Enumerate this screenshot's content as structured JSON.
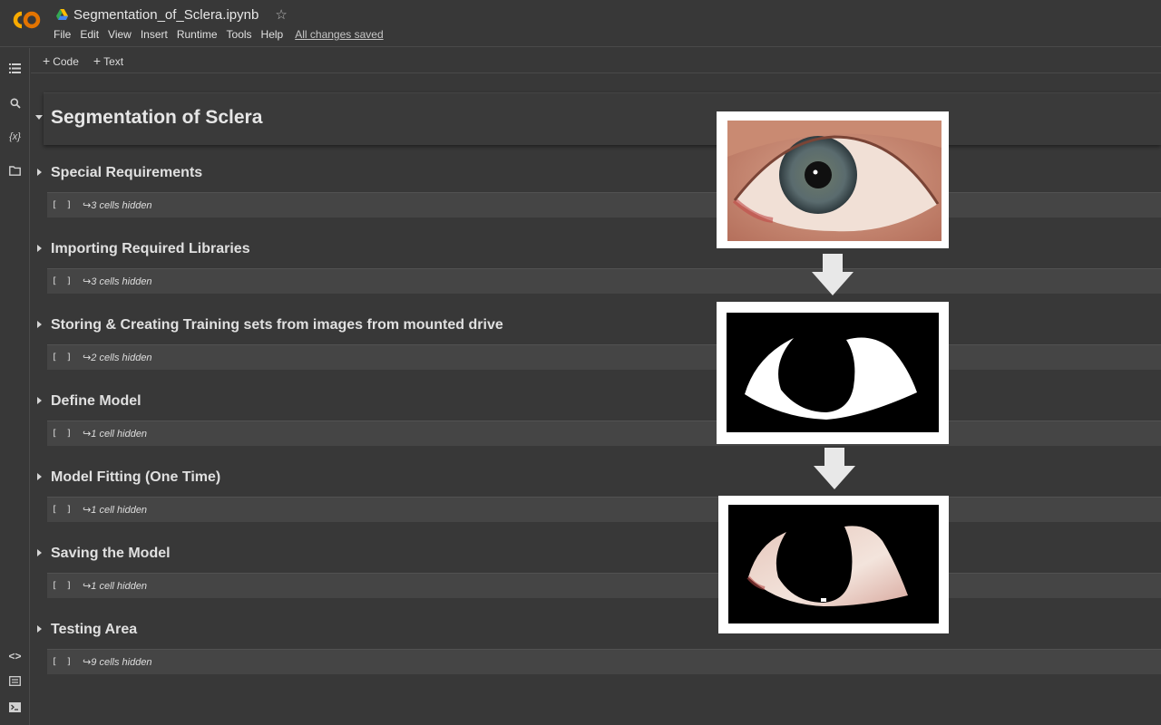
{
  "header": {
    "notebook_title": "Segmentation_of_Sclera.ipynb",
    "logo_text": "CO",
    "menu": [
      "File",
      "Edit",
      "View",
      "Insert",
      "Runtime",
      "Tools",
      "Help"
    ],
    "save_status": "All changes saved"
  },
  "toolbar": {
    "add_code": "Code",
    "add_text": "Text"
  },
  "notebook": {
    "main_heading": "Segmentation of Sclera",
    "sections": [
      {
        "title": "Special Requirements",
        "hidden": "3 cells hidden"
      },
      {
        "title": "Importing Required Libraries",
        "hidden": "3 cells hidden"
      },
      {
        "title": "Storing & Creating Training sets from images from mounted drive",
        "hidden": "2 cells hidden"
      },
      {
        "title": "Define Model",
        "hidden": "1 cell hidden"
      },
      {
        "title": "Model Fitting (One Time)",
        "hidden": "1 cell hidden"
      },
      {
        "title": "Saving the Model",
        "hidden": "1 cell hidden"
      },
      {
        "title": "Testing Area",
        "hidden": "9 cells hidden"
      }
    ],
    "bracket": "[ ]",
    "hidden_arrow": "↪"
  },
  "icons": {
    "rail": [
      "toc-icon",
      "search-icon",
      "variables-icon",
      "folder-icon",
      "code-snippets-icon",
      "command-palette-icon",
      "terminal-icon"
    ]
  },
  "colors": {
    "background": "#383838",
    "logo_orange": "#f9ab00",
    "logo_yellow": "#e37400"
  }
}
